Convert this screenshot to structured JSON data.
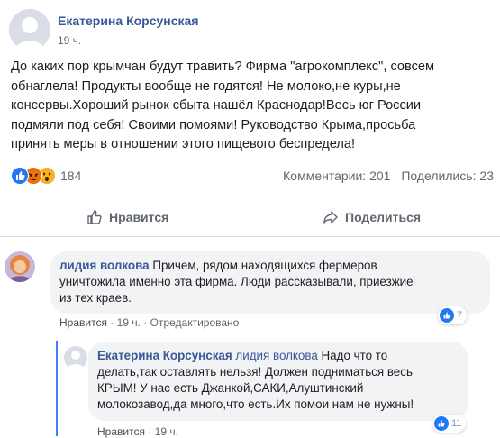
{
  "post": {
    "author": "Екатерина Корсунская",
    "time": "19 ч.",
    "lines": [
      "До каких пор крымчан будут травить? Фирма \"агрокомплекс\", совсем",
      "обнаглела! Продукты вообще не годятся! Не молоко,не куры,не",
      "консервы.Хороший рынок сбыта нашёл Краснодар!Весь юг России",
      "подмяли под себя! Своими помоями! Руководство Крыма,просьба",
      "принять меры в отношении этого пищевого беспредела!"
    ],
    "reactions": {
      "icons": [
        "like-icon",
        "angry-icon",
        "wow-icon"
      ],
      "colors": [
        "#2078f4",
        "#e9710f",
        "#f7b125"
      ],
      "count": "184"
    },
    "comments_stat": "Комментарии: 201",
    "shares_stat": "Поделились: 23"
  },
  "actions": {
    "like": "Нравится",
    "share": "Поделиться"
  },
  "comments": [
    {
      "author": "лидия волкова",
      "lines": [
        "Причем, рядом находящихся фермеров",
        "уничтожила именно эта фирма. Люди рассказывали, приезжие",
        "из тех краев."
      ],
      "like_label": "Нравится",
      "time": "19 ч.",
      "edited": "Отредактировано",
      "likes": "7"
    },
    {
      "author": "Екатерина Корсунская",
      "mention": "лидия волкова",
      "first_text": "Надо что то",
      "lines": [
        "делать,так оставлять нельзя! Должен подниматься весь",
        "КРЫМ! У нас есть Джанкой,САКИ,Алуштинский",
        "молокозавод,да много,что есть.Их помои нам не нужны!"
      ],
      "like_label": "Нравится",
      "time": "19 ч.",
      "likes": "11"
    }
  ],
  "separator": "·",
  "colors": {
    "link": "#385898",
    "meta": "#616770",
    "bubble": "#f2f3f5",
    "accent": "#4080ff"
  }
}
